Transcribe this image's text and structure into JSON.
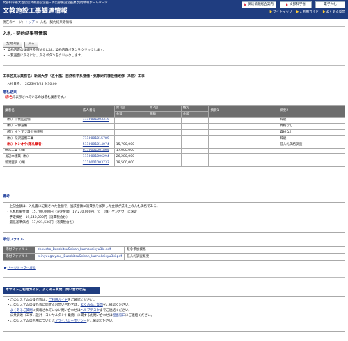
{
  "header": {
    "subtitle": "文部科学省大臣官房文教施設企画・防災部施設企画課 契約情報ホームページ",
    "title": "文教施設工事調達情報",
    "buttons": [
      "調達情報総合案内",
      "文部科学省",
      "電子入札"
    ],
    "links": [
      "サイトマップ",
      "ご利用ガイド",
      "よくある質問"
    ]
  },
  "breadcrumb": {
    "prefix": "現在のページ：",
    "top": "トップ",
    "sep": ">",
    "current": "入札・契約結果等情報"
  },
  "page_title": "入札・契約結果等情報",
  "buttons": {
    "contract": "契約内容",
    "back": "戻る"
  },
  "notes": [
    "契約内容の詳細を参照するには，契約内容ボタンをクリックします。",
    "一覧画面に戻るには，戻るボタンをクリックします。"
  ],
  "project": "工事名又は業務名：新潟大学（五十嵐）自然科学系整備・気象研究棟設備改修（R館）工事",
  "date_label": "入札日時：",
  "date_value": "2023/07/25 9:30:00",
  "results": {
    "heading": "落札結果",
    "legend_red": "（赤色",
    "legend_rest": "で表示されているのは落札業者です。）",
    "headers": [
      "業者名",
      "法人番号",
      "第1回",
      "第2回",
      "随契",
      "摘要1",
      "摘要2"
    ],
    "subheader": "金額",
    "rows": [
      {
        "name": "（株）千代田設備",
        "corp": "1110001003319",
        "r1": "",
        "r2": "",
        "zuikei": "",
        "t1": "",
        "t2": "辞退",
        "winner": false
      },
      {
        "name": "（株）日伸設備",
        "corp": "",
        "r1": "",
        "r2": "",
        "zuikei": "",
        "t1": "",
        "t2": "資格なし",
        "winner": false
      },
      {
        "name": "（有）オヤマツ設計事務所",
        "corp": "",
        "r1": "",
        "r2": "",
        "zuikei": "",
        "t1": "",
        "t2": "資格なし",
        "winner": false
      },
      {
        "name": "（株）深沢設備工業",
        "corp": "7110001015789",
        "r1": "",
        "r2": "",
        "zuikei": "",
        "t1": "",
        "t2": "辞退",
        "winner": false
      },
      {
        "name": "（株）ケンオウ(落札業者)",
        "corp": "5110001014074",
        "r1": "15,700,000",
        "r2": "",
        "zuikei": "",
        "t1": "",
        "t2": "低入札価格調査",
        "winner": true
      },
      {
        "name": "研水工業（株）",
        "corp": "6110001001864",
        "r1": "17,000,000",
        "r2": "",
        "zuikei": "",
        "t1": "",
        "t2": "",
        "winner": false
      },
      {
        "name": "長辺本建築（株）",
        "corp": "1110001006294",
        "r1": "26,280,000",
        "r2": "",
        "zuikei": "",
        "t1": "",
        "t2": "",
        "winner": false
      },
      {
        "name": "新潟空調（株）",
        "corp": "1110001003733",
        "r1": "18,500,000",
        "r2": "",
        "zuikei": "",
        "t1": "",
        "t2": "",
        "winner": false
      }
    ]
  },
  "remarks": {
    "heading": "備考",
    "lines": [
      "・上記金額は，入札書に記載された金額で，当該金額に消費税を加算した金額が法律上の入札価格である。",
      "・入札結果金額　15,700,000円（決定金額　17,270,000円）で　（株）ケンオウ　に決定",
      "・予定価格　19,540,000円（消費税含む）",
      "・最低基準価格　17,921,536円（消費税含む）"
    ]
  },
  "attachments": {
    "heading": "添付ファイル",
    "rows": [
      {
        "label": "添付ファイル１",
        "file": "chousho_BusshitsuSeisan_kuchokaisyu3ki.pdf",
        "desc": "競争参加資格"
      },
      {
        "label": "添付ファイル２",
        "file": "teinyuugaiyou__BusshitsuSeisan_kuchokaisyu3ki.pdf",
        "desc": "低入札調査概要"
      }
    ]
  },
  "page_top": "ページトップへ戻る",
  "contact": {
    "heading": "本サイトご利用ガイド，よくある質問，問い合わせ先",
    "lines": [
      [
        "このシステムの操作等は，",
        "ご利用ガイド",
        "をご確認ください。"
      ],
      [
        "このシステムの操作等に関するお問い合わせは，",
        "よくあるご質問",
        "をご確認ください。"
      ],
      [
        "",
        "よくあるご質問",
        "に掲載されていない問い合わせは",
        "ヘルプデスク",
        "までご連絡ください。"
      ],
      [
        "公共調達（工事，設計・コンサルタント業務）に関するお問い合わせは",
        "担当窓口",
        "にご連絡ください。"
      ],
      [
        "このシステムの利用については",
        "プライバシーポリシー",
        "をご確認ください。"
      ]
    ]
  }
}
